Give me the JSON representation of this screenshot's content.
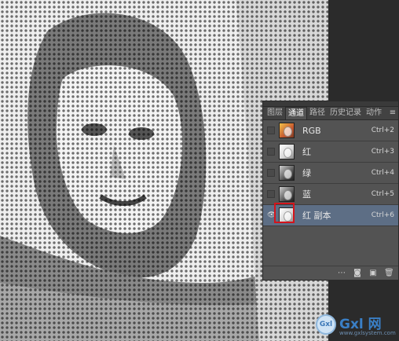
{
  "panel": {
    "tabs": [
      {
        "label": "图层",
        "active": false
      },
      {
        "label": "通道",
        "active": true
      },
      {
        "label": "路径",
        "active": false
      },
      {
        "label": "历史记录",
        "active": false
      },
      {
        "label": "动作",
        "active": false
      }
    ],
    "menu_icon": "panel-menu-icon",
    "channels": [
      {
        "label": "RGB",
        "shortcut": "Ctrl+2",
        "thumb": "rgb",
        "selected": false,
        "visible": false
      },
      {
        "label": "红",
        "shortcut": "Ctrl+3",
        "thumb": "light",
        "selected": false,
        "visible": false
      },
      {
        "label": "绿",
        "shortcut": "Ctrl+4",
        "thumb": "dark",
        "selected": false,
        "visible": false
      },
      {
        "label": "蓝",
        "shortcut": "Ctrl+5",
        "thumb": "dark",
        "selected": false,
        "visible": false
      },
      {
        "label": "红 副本",
        "shortcut": "Ctrl+6",
        "thumb": "light",
        "selected": true,
        "visible": true
      }
    ],
    "bottom_icons": [
      "load-selection-icon",
      "save-selection-icon",
      "new-channel-icon",
      "delete-channel-icon"
    ]
  },
  "watermark": {
    "brand": "Gxl 网",
    "logo": "Gxl",
    "url": "www.gxlsystem.com"
  },
  "colors": {
    "panel_bg": "#535353",
    "selected_row": "#5d6e85",
    "highlight_box": "#d4141b",
    "watermark_blue": "#3a7fc6"
  }
}
